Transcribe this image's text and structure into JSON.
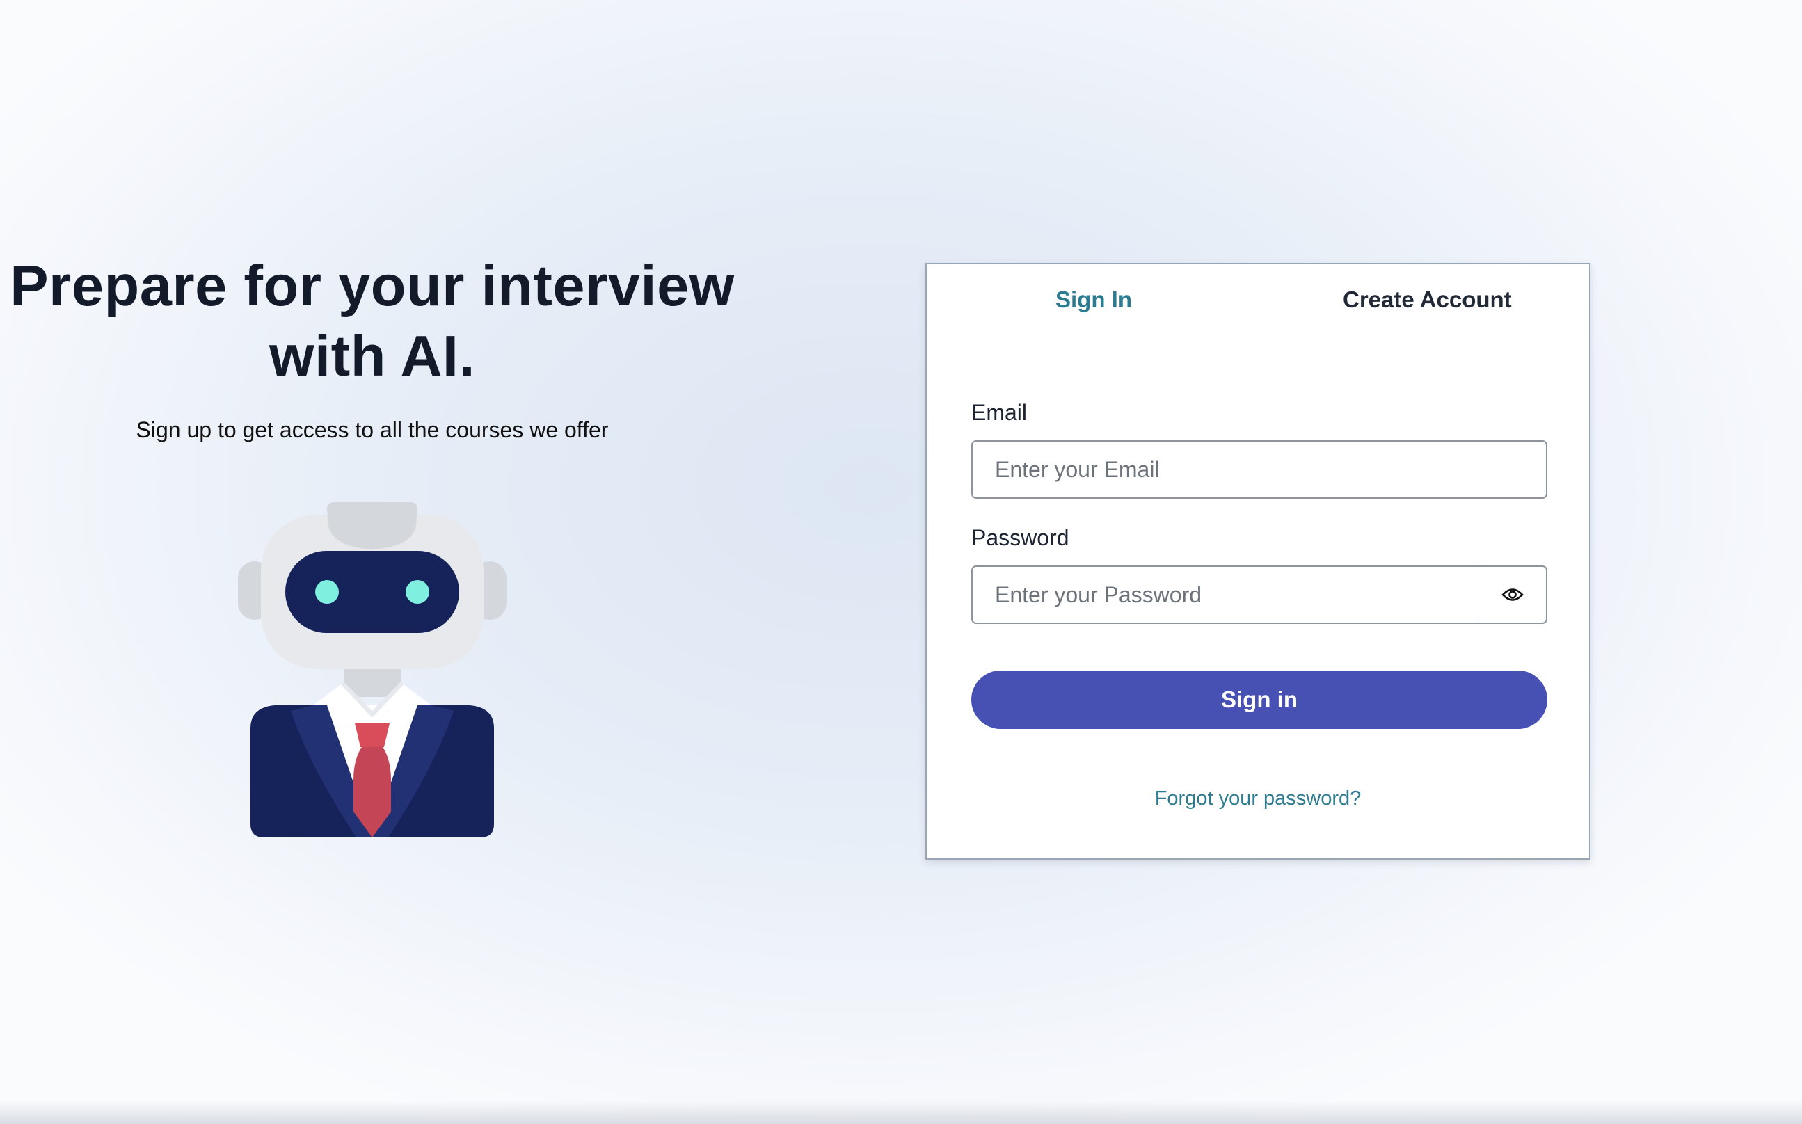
{
  "hero": {
    "title_line1": "Prepare for your interview",
    "title_line2": "with AI.",
    "subtitle": "Sign up to get access to all the courses we offer",
    "illustration": "robot-in-suit"
  },
  "auth_card": {
    "tabs": [
      {
        "label": "Sign In",
        "active": true
      },
      {
        "label": "Create Account",
        "active": false
      }
    ],
    "email": {
      "label": "Email",
      "placeholder": "Enter your Email",
      "value": ""
    },
    "password": {
      "label": "Password",
      "placeholder": "Enter your Password",
      "value": "",
      "toggle_icon": "eye-icon"
    },
    "submit_label": "Sign in",
    "forgot_link": "Forgot your password?"
  },
  "colors": {
    "accent_teal": "#2c7b90",
    "button_indigo": "#4750b3",
    "heading": "#131a2a",
    "robot_navy": "#16225a",
    "robot_eye": "#7ff0e0",
    "robot_tie": "#d94d5a"
  }
}
